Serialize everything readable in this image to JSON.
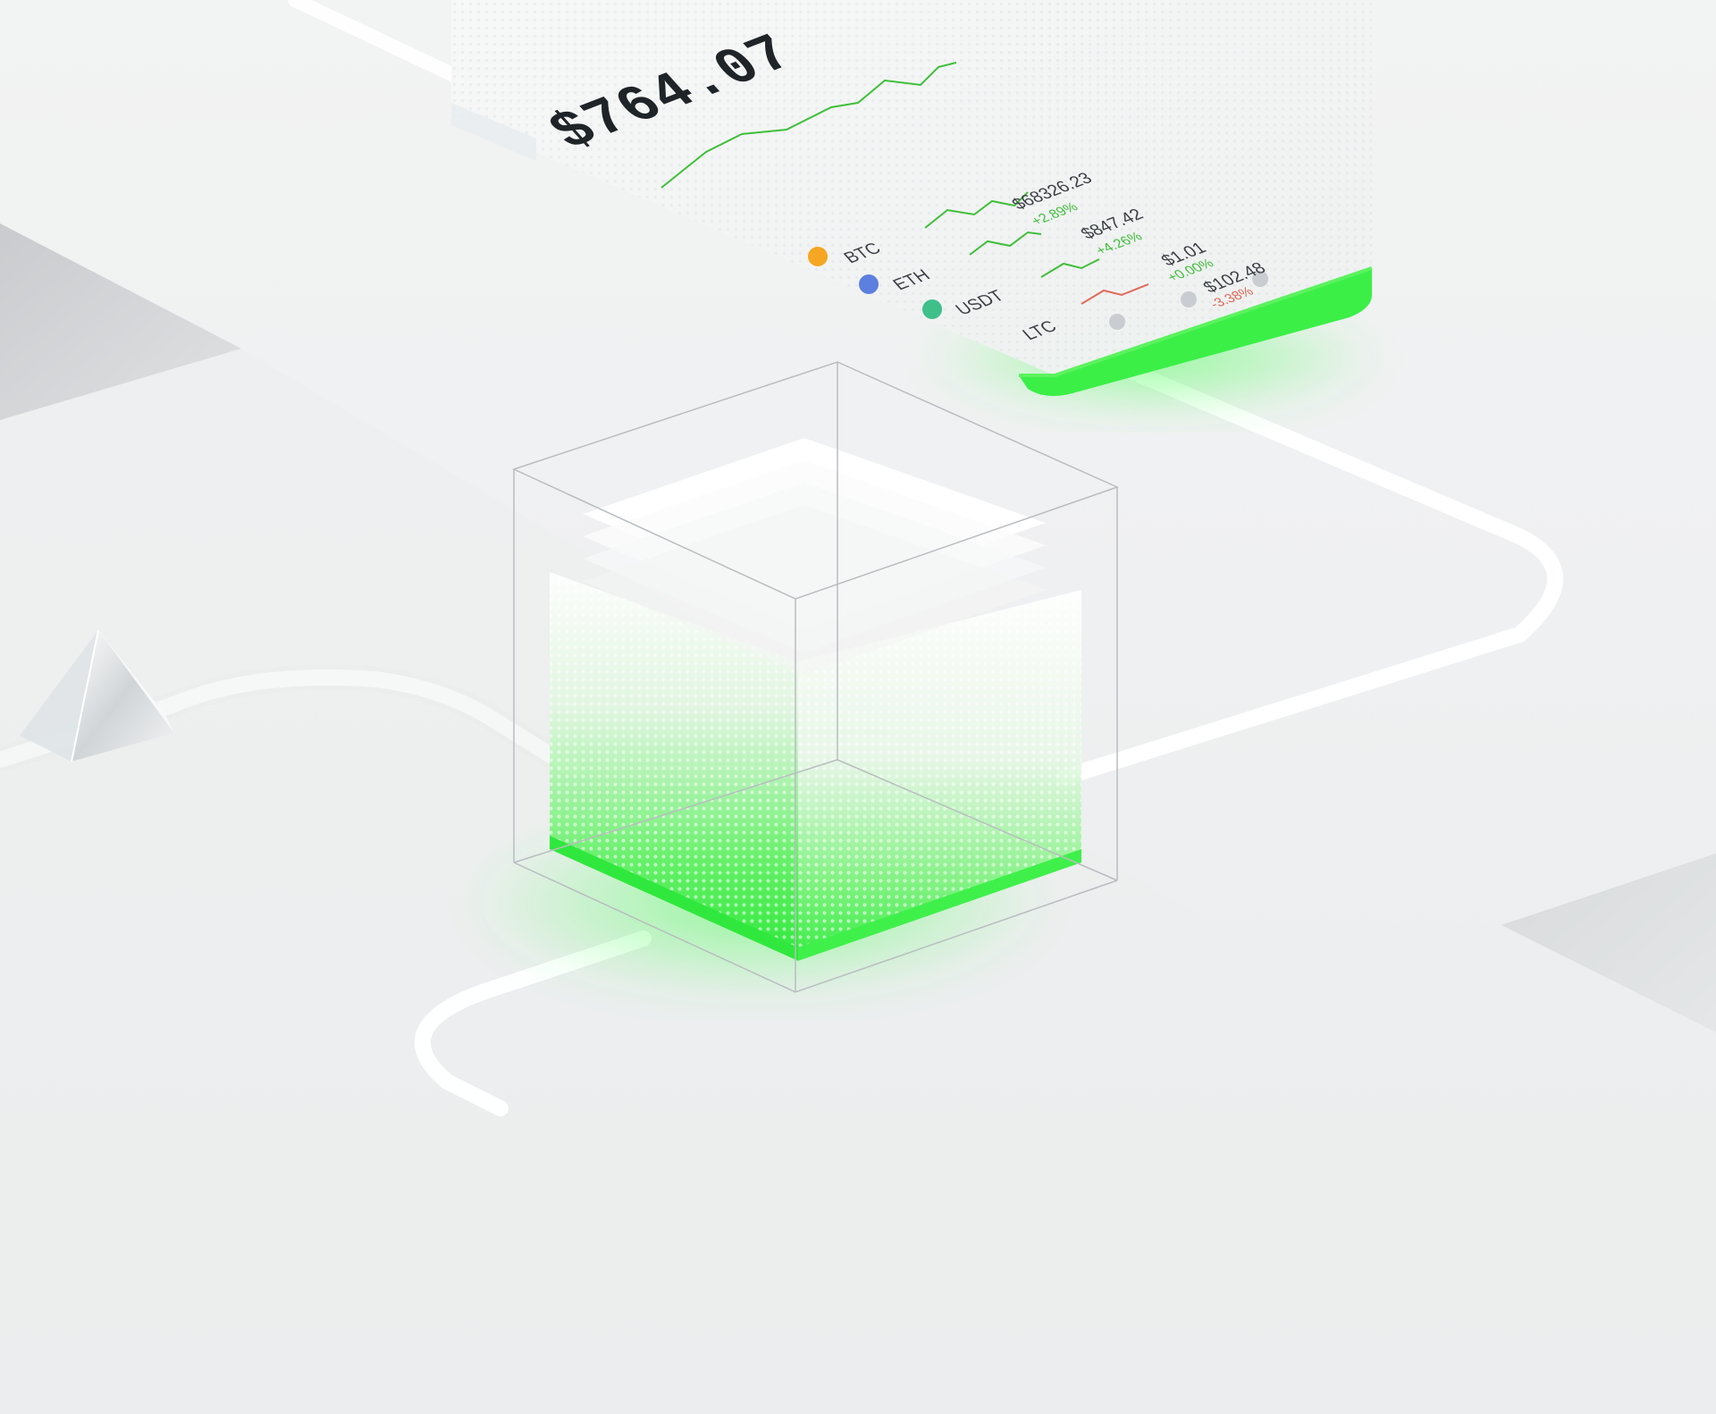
{
  "phone": {
    "balance": "$764.07",
    "assets": [
      {
        "name": "BTC",
        "price": "$68326.23",
        "change": "+2.89%",
        "change_color": "#3fbf3a"
      },
      {
        "name": "ETH",
        "price": "$847.42",
        "change": "+4.26%",
        "change_color": "#3fbf3a"
      },
      {
        "name": "USDT",
        "price": "$1.01",
        "change": "+0.00%",
        "change_color": "#3fbf3a"
      },
      {
        "name": "LTC",
        "price": "$102.48",
        "change": "-3.38%",
        "change_color": "#e26a5a"
      }
    ]
  },
  "colors": {
    "accent": "#3df24a",
    "background": "#eef0f1"
  }
}
